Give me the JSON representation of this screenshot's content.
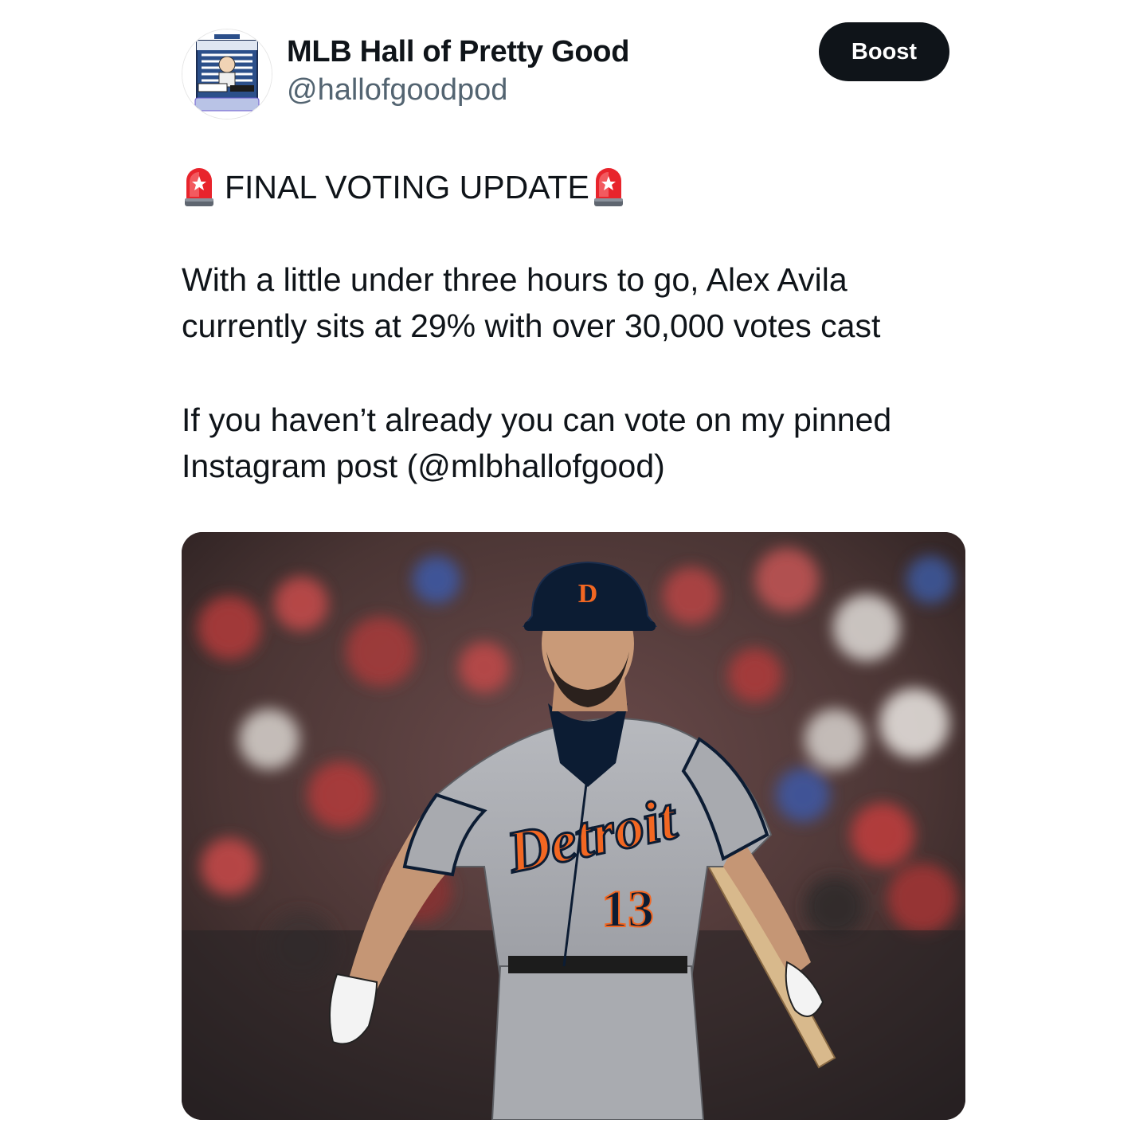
{
  "author": {
    "display_name": "MLB Hall of Pretty Good",
    "handle": "@hallofgoodpod",
    "avatar_icon": "baseball-hall-of-pretty-good-podcast-logo"
  },
  "actions": {
    "boost_label": "Boost"
  },
  "post": {
    "headline": "FINAL VOTING UPDATE",
    "headline_icon": "rotating-light-siren-emoji",
    "paragraph_1": "With a little under three hours to go, Alex Avila\ncurrently sits at 29% with over 30,000 votes cast",
    "paragraph_2": "If you haven’t already you can vote on my pinned\nInstagram post (@mlbhallofgood)"
  },
  "media": {
    "alt_subject": "baseball-player-photo",
    "jersey_script": "Detroit",
    "jersey_number": "13"
  },
  "colors": {
    "text_primary": "#0f1419",
    "text_secondary": "#536471",
    "button_bg": "#0f1419",
    "button_text": "#ffffff",
    "jersey_gray": "#a7a9ae",
    "navy": "#0c1c33",
    "orange": "#f26722"
  }
}
